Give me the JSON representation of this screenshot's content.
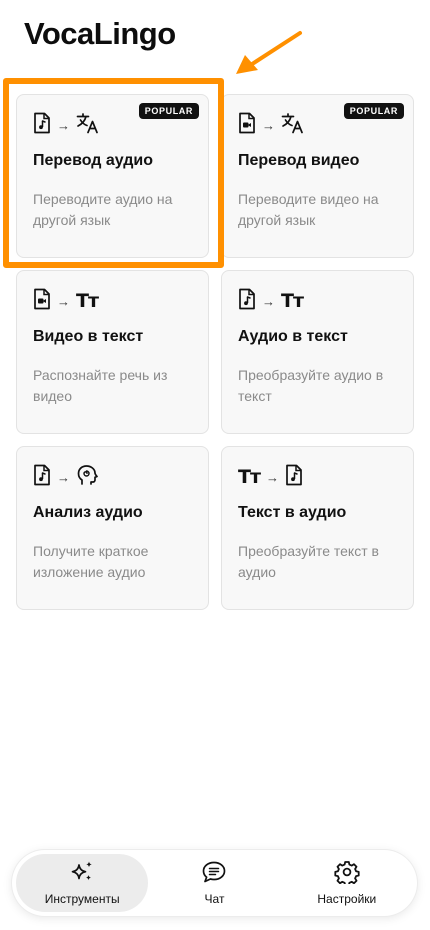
{
  "app": {
    "title": "VocaLingo"
  },
  "cards": [
    {
      "title": "Перевод аудио",
      "description": "Переводите аудио на другой язык",
      "badge": "POPULAR",
      "from_icon": "audio-file-icon",
      "to_icon": "translate-icon"
    },
    {
      "title": "Перевод видео",
      "description": "Переводите видео на другой язык",
      "badge": "POPULAR",
      "from_icon": "video-file-icon",
      "to_icon": "translate-icon"
    },
    {
      "title": "Видео в текст",
      "description": "Распознайте речь из видео",
      "from_icon": "video-file-icon",
      "to_icon": "text-tt-icon"
    },
    {
      "title": "Аудио в текст",
      "description": "Преобразуйте аудио в текст",
      "from_icon": "audio-file-icon",
      "to_icon": "text-tt-icon"
    },
    {
      "title": "Анализ аудио",
      "description": "Получите краткое изложение аудио",
      "from_icon": "audio-file-icon",
      "to_icon": "head-analysis-icon"
    },
    {
      "title": "Текст в аудио",
      "description": "Преобразуйте текст в аудио",
      "from_icon": "text-tt-icon",
      "to_icon": "audio-file-icon"
    }
  ],
  "icons": {
    "arrow": "→",
    "text_tt": "Tт"
  },
  "nav": {
    "items": [
      {
        "label": "Инструменты",
        "icon": "sparkles-icon",
        "active": true
      },
      {
        "label": "Чат",
        "icon": "chat-bubble-icon",
        "active": false
      },
      {
        "label": "Настройки",
        "icon": "gear-icon",
        "active": false
      }
    ]
  },
  "colors": {
    "highlight": "#ff9000",
    "card_bg": "#f8f8f8",
    "badge_bg": "#111111",
    "muted_text": "#8a8a8a"
  }
}
